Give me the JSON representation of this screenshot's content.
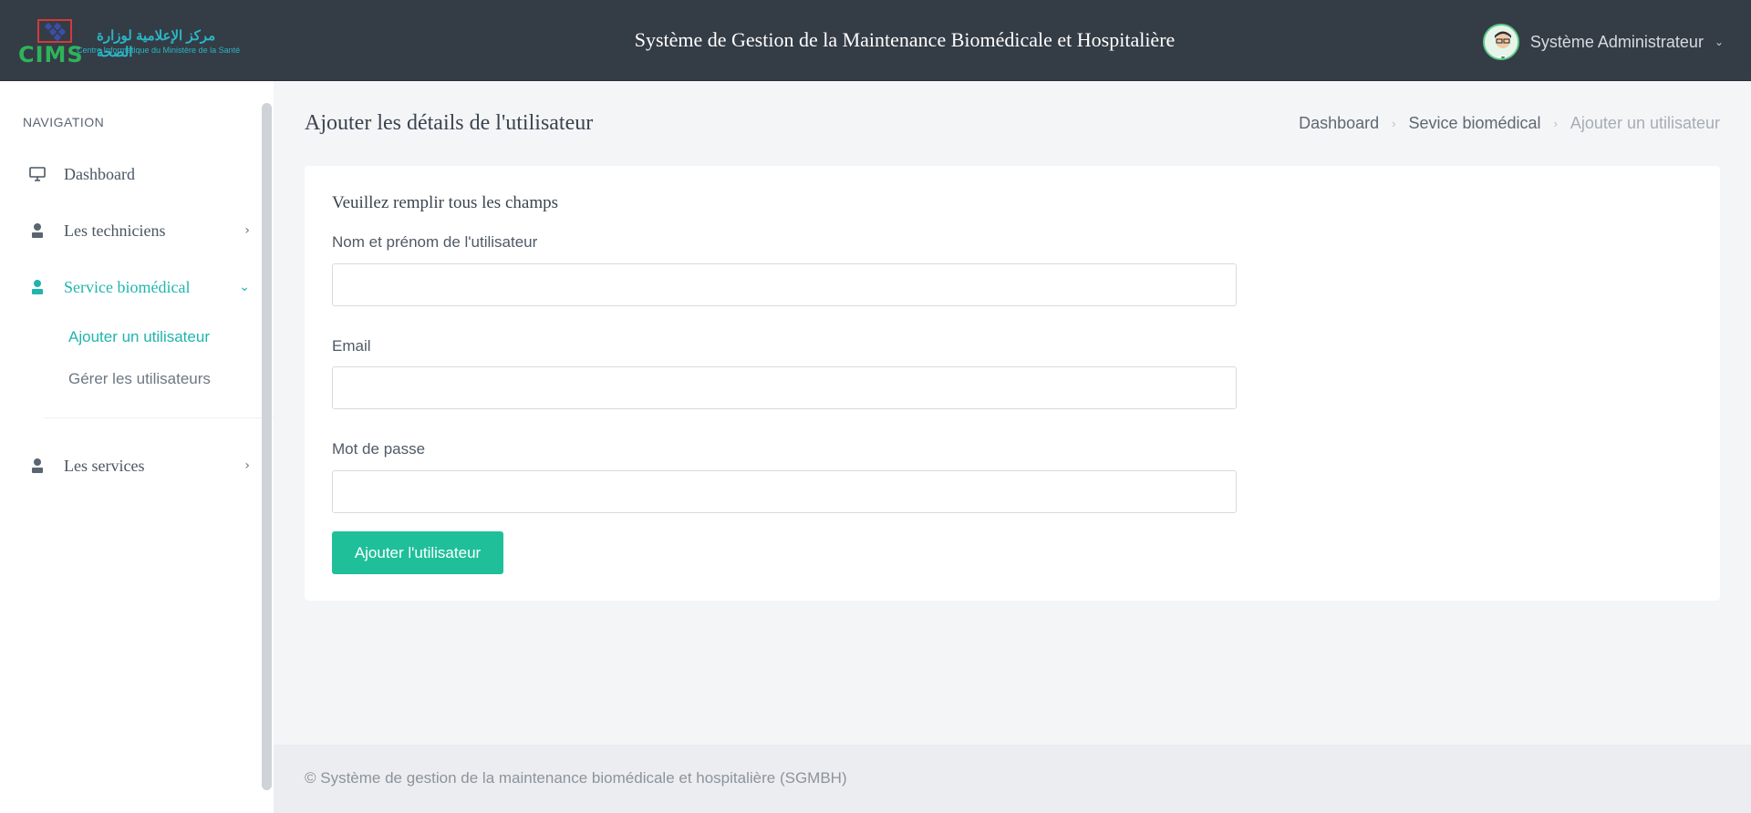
{
  "header": {
    "logo": {
      "text": "CIMS",
      "arabic": "مركز الإعلامية لوزارة الصحة",
      "subtitle": "Centre Informatique du Ministère de la Santé"
    },
    "title": "Système de Gestion de la Maintenance Biomédicale et Hospitalière",
    "user_name": "Système Administrateur"
  },
  "sidebar": {
    "heading": "NAVIGATION",
    "items": [
      {
        "label": "Dashboard",
        "icon": "monitor-icon"
      },
      {
        "label": "Les techniciens",
        "icon": "user-icon"
      },
      {
        "label": "Service biomédical",
        "icon": "user-icon",
        "active": true,
        "children": [
          {
            "label": "Ajouter un utilisateur",
            "active": true
          },
          {
            "label": "Gérer les utilisateurs"
          }
        ]
      },
      {
        "label": "Les services",
        "icon": "user-icon"
      }
    ]
  },
  "main": {
    "page_title": "Ajouter les détails de l'utilisateur",
    "breadcrumb": [
      "Dashboard",
      "Sevice biomédical",
      "Ajouter un utilisateur"
    ],
    "form": {
      "instruction": "Veuillez remplir tous les champs",
      "fields": [
        {
          "label": "Nom et prénom de l'utilisateur",
          "value": "",
          "placeholder": ""
        },
        {
          "label": "Email",
          "value": "",
          "placeholder": ""
        },
        {
          "label": "Mot de passe",
          "value": "",
          "placeholder": ""
        }
      ],
      "submit_label": "Ajouter l'utilisateur"
    }
  },
  "footer": {
    "text": "© Système de gestion de la maintenance biomédicale et hospitalière (SGMBH)"
  },
  "colors": {
    "topbar": "#343c46",
    "accent": "#1fb5ad",
    "button": "#1fbf9a"
  }
}
